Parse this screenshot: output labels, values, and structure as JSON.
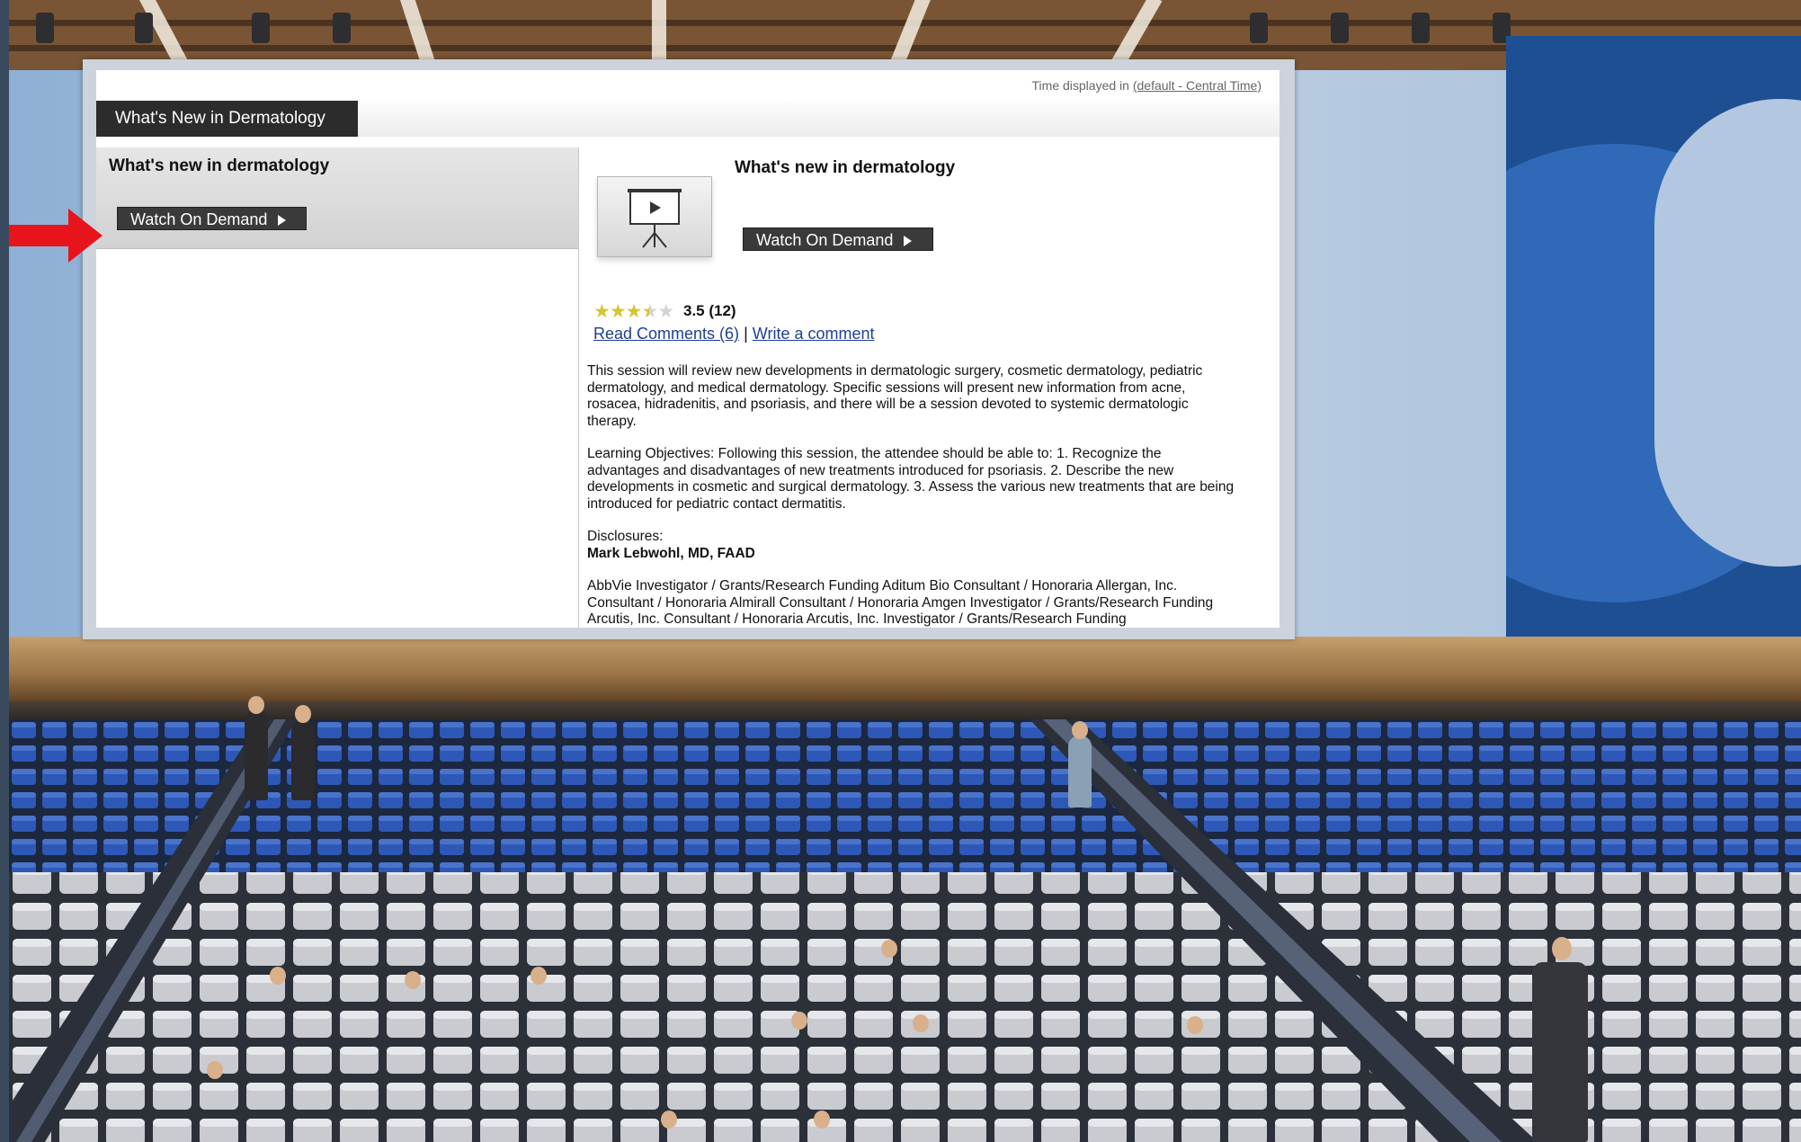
{
  "header": {
    "timezone_prefix": "Time displayed in ",
    "timezone_link": "(default - Central Time)"
  },
  "tab": {
    "label": "What's New in Dermatology"
  },
  "session_list": {
    "items": [
      {
        "title": "What's new in dermatology",
        "button_label": "Watch On Demand"
      }
    ]
  },
  "session_detail": {
    "title": "What's new in dermatology",
    "button_label": "Watch On Demand",
    "rating": {
      "stars": 3.5,
      "score_text": "3.5 (12)"
    },
    "read_comments_link": "Read Comments (6)",
    "separator": "|",
    "write_comment_link": "Write a comment",
    "description": "This session will review new developments in dermatologic surgery, cosmetic dermatology, pediatric dermatology, and medical dermatology. Specific sessions will present new information from acne, rosacea, hidradenitis, and psoriasis, and there will be a session devoted to systemic dermatologic therapy.",
    "objectives": "Learning Objectives: Following this session, the attendee should be able to: 1. Recognize the advantages and disadvantages of new treatments introduced for psoriasis. 2. Describe the new developments in cosmetic and surgical dermatology. 3. Assess the various new treatments that are being introduced for pediatric contact dermatitis.",
    "disclosures_label": "Disclosures:",
    "presenter": "Mark Lebwohl, MD, FAAD",
    "disclosures_text": "AbbVie Investigator / Grants/Research Funding Aditum Bio Consultant / Honoraria Allergan, Inc. Consultant / Honoraria Almirall Consultant / Honoraria Amgen Investigator / Grants/Research Funding Arcutis, Inc. Consultant / Honoraria Arcutis, Inc. Investigator / Grants/Research Funding"
  },
  "colors": {
    "accent_dark": "#2c2c2c",
    "link": "#1f3f93",
    "star": "#d6c434",
    "arrow": "#e8141b"
  },
  "icons": {
    "thumbnail": "projector-screen-icon",
    "play": "play-triangle-icon",
    "pointer": "red-arrow-icon"
  }
}
